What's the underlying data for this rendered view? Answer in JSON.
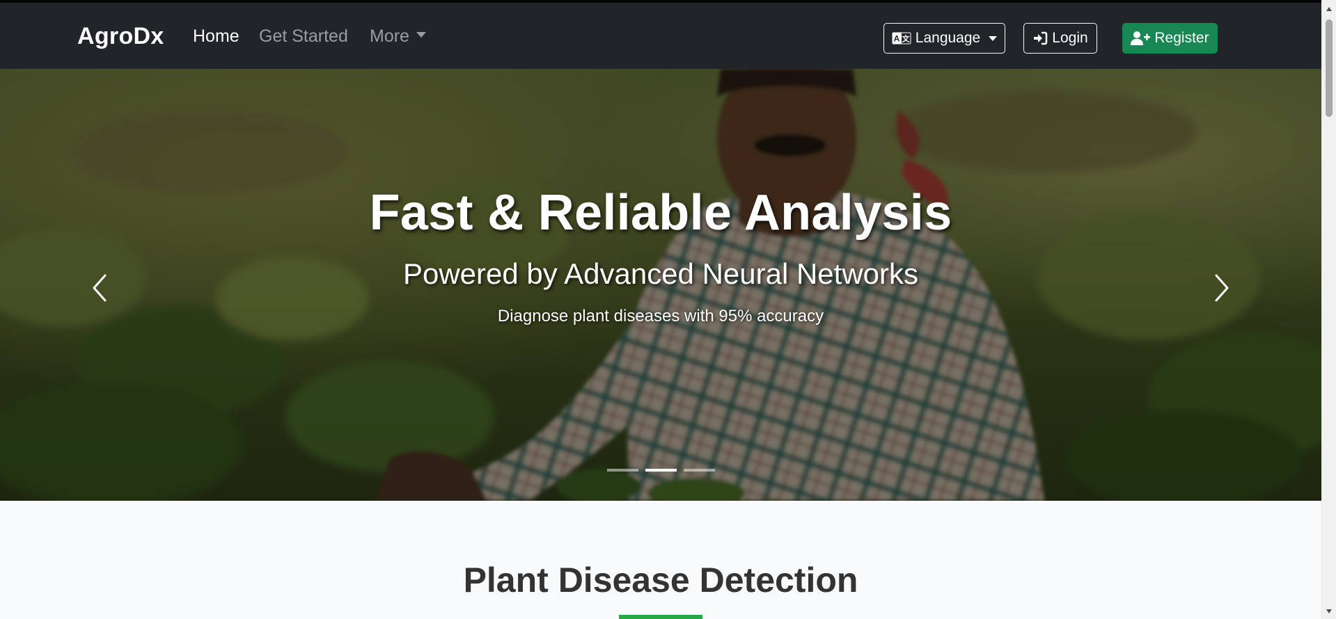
{
  "navbar": {
    "brand": "AgroDx",
    "links": [
      {
        "label": "Home",
        "active": true
      },
      {
        "label": "Get Started",
        "active": false
      },
      {
        "label": "More",
        "dropdown": true
      }
    ],
    "buttons": {
      "language": {
        "label": "Language",
        "icon": "language-icon"
      },
      "login": {
        "label": "Login",
        "icon": "login-icon"
      },
      "register": {
        "label": "Register",
        "icon": "user-plus-icon"
      }
    }
  },
  "hero": {
    "title": "Fast & Reliable Analysis",
    "subtitle": "Powered by Advanced Neural Networks",
    "text": "Diagnose plant diseases with 95% accuracy",
    "slide_count": 3,
    "active_slide": 2,
    "prev_icon": "chevron-left-icon",
    "next_icon": "chevron-right-icon"
  },
  "section": {
    "title": "Plant Disease Detection"
  },
  "colors": {
    "navbar_bg": "#212529",
    "register_bg": "#198754",
    "accent_underline": "#28a745",
    "page_bg": "#f8f9fa"
  }
}
